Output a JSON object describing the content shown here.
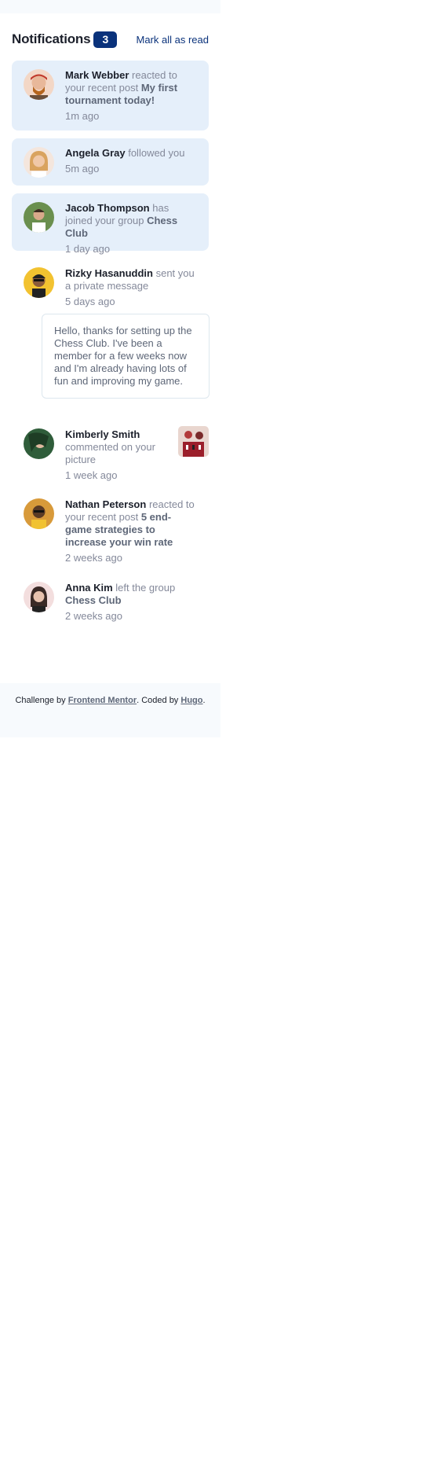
{
  "header": {
    "title": "Notifications",
    "unread_count": "3",
    "mark_all": "Mark all as read"
  },
  "notifications": [
    {
      "name": "Mark Webber",
      "action": "reacted to your recent post",
      "target": "My first tournament today!",
      "time": "1m ago",
      "unread": true,
      "avatar_icon": "avatar-mark"
    },
    {
      "name": "Angela Gray",
      "action": "followed you",
      "target": "",
      "time": "5m ago",
      "unread": true,
      "avatar_icon": "avatar-angela"
    },
    {
      "name": "Jacob Thompson",
      "action": "has joined your group",
      "target": "Chess Club",
      "time": "1 day ago",
      "unread": true,
      "avatar_icon": "avatar-jacob"
    },
    {
      "name": "Rizky Hasanuddin",
      "action": "sent you a private message",
      "target": "",
      "time": "5 days ago",
      "unread": false,
      "avatar_icon": "avatar-rizky",
      "message": "Hello, thanks for setting up the Chess Club. I've been a member for a few weeks now and I'm already having lots of fun and improving my game."
    },
    {
      "name": "Kimberly Smith",
      "action": "commented on your picture",
      "target": "",
      "time": "1 week ago",
      "unread": false,
      "avatar_icon": "avatar-kimberly",
      "picture_icon": "chess-picture"
    },
    {
      "name": "Nathan Peterson",
      "action": "reacted to your recent post",
      "target": "5 end-game strategies to increase your win rate",
      "time": "2 weeks ago",
      "unread": false,
      "avatar_icon": "avatar-nathan"
    },
    {
      "name": "Anna Kim",
      "action": "left the group",
      "target": "Chess Club",
      "time": "2 weeks ago",
      "unread": false,
      "avatar_icon": "avatar-anna"
    }
  ],
  "footer": {
    "prefix": "Challenge by",
    "frontend_mentor": "Frontend Mentor",
    "middle": ". Coded by",
    "author": "Hugo",
    "suffix": "."
  },
  "colors": {
    "accent": "#0a327b",
    "unread_bg": "#e5effa",
    "text_dark": "#1c202b",
    "text_muted": "#84899a"
  }
}
